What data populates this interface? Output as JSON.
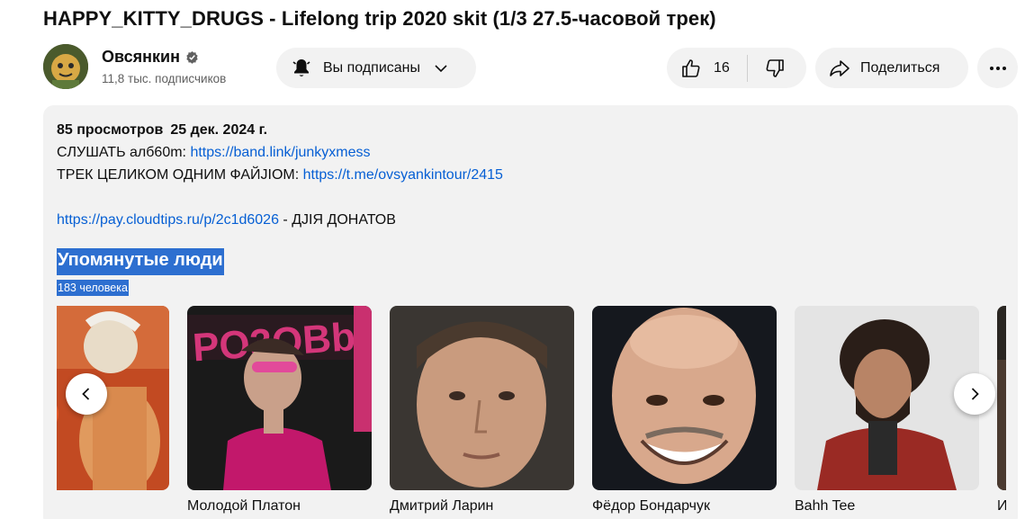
{
  "video": {
    "title": "HAPPY_KITTY_DRUGS - Lifelong trip 2020 skit (1/3 27.5-часовой трек)"
  },
  "channel": {
    "name": "Овсянкин",
    "subscribers": "11,8 тыс. подписчиков",
    "verified_icon": "verified-badge-icon"
  },
  "actions": {
    "subscribe_label": "Вы подписаны",
    "like_count": "16",
    "share_label": "Поделиться"
  },
  "description": {
    "views": "85 просмотров",
    "date": "25 дек. 2024 г.",
    "lines": [
      {
        "prefix": "CЛУШАТЬ алб60m: ",
        "link": "https://band.link/junkyxmess",
        "suffix": ""
      },
      {
        "prefix": "ТРЕК ЦЕЛИКОМ ОДНИМ ФАЙJIOM: ",
        "link": "https://t.me/ovsyankintour/2415",
        "suffix": ""
      },
      {
        "prefix": "",
        "link": "https://pay.cloudtips.ru/p/2c1d6026",
        "suffix": " - ДJIЯ ДОНАТОВ"
      }
    ]
  },
  "people": {
    "title": "Упомянутые люди",
    "count": "183 человека",
    "cards": [
      {
        "name": ""
      },
      {
        "name": "Молодой Платон"
      },
      {
        "name": "Дмитрий Ларин"
      },
      {
        "name": "Фёдор Бондарчук"
      },
      {
        "name": "Bahh Tee"
      },
      {
        "name": "И"
      }
    ]
  },
  "colors": {
    "link": "#065fd4",
    "selection": "#2d6fd0",
    "button_bg": "#f2f2f2"
  }
}
